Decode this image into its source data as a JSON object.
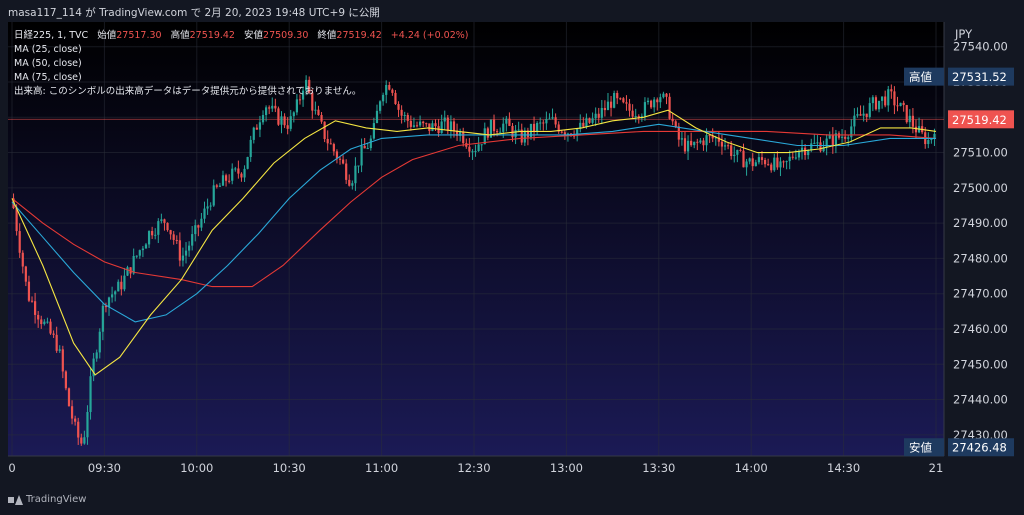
{
  "header": {
    "publish_text": "masa117_114 が TradingView.com で 2月 20, 2023 19:48 UTC+9 に公開"
  },
  "legend": {
    "symbol": "日経225, 1, TVC",
    "open_label": "始値",
    "open": "27517.30",
    "high_label": "高値",
    "high": "27519.42",
    "low_label": "安値",
    "low": "27509.30",
    "close_label": "終値",
    "close": "27519.42",
    "change": "+4.24 (+0.02%)",
    "ma1": "MA (25, close)",
    "ma2": "MA (50, close)",
    "ma3": "MA (75, close)",
    "volume_note": "出来高: このシンボルの出来高データはデータ提供元から提供されておりません。"
  },
  "footer": {
    "brand": "TradingView"
  },
  "colors": {
    "up": "#26a69a",
    "down": "#ef5350",
    "ma25": "#f5e642",
    "ma50": "#2aa8d8",
    "ma75": "#e53935",
    "bg_top": "#000000",
    "bg_bottom": "#1b1a55",
    "axis_bg": "#131722"
  },
  "chart_data": {
    "type": "candlestick",
    "currency": "JPY",
    "y_range": [
      27424,
      27547
    ],
    "y_ticks": [
      27430,
      27440,
      27450,
      27460,
      27470,
      27480,
      27490,
      27500,
      27510,
      27520,
      27530,
      27540
    ],
    "x_ticks": [
      {
        "label": "0",
        "t": 0
      },
      {
        "label": "09:30",
        "t": 30
      },
      {
        "label": "10:00",
        "t": 60
      },
      {
        "label": "10:30",
        "t": 90
      },
      {
        "label": "11:00",
        "t": 120
      },
      {
        "label": "12:30",
        "t": 150
      },
      {
        "label": "13:00",
        "t": 180
      },
      {
        "label": "13:30",
        "t": 210
      },
      {
        "label": "14:00",
        "t": 240
      },
      {
        "label": "14:30",
        "t": 270
      },
      {
        "label": "21",
        "t": 300
      }
    ],
    "markers": {
      "high": {
        "label": "高値",
        "value": "27531.52"
      },
      "last": {
        "value": "27519.42"
      },
      "low": {
        "label": "安値",
        "value": "27426.48"
      }
    },
    "price_path": [
      [
        0,
        27497
      ],
      [
        5,
        27470
      ],
      [
        10,
        27462
      ],
      [
        15,
        27455
      ],
      [
        18,
        27440
      ],
      [
        21,
        27430
      ],
      [
        23,
        27427
      ],
      [
        26,
        27448
      ],
      [
        30,
        27468
      ],
      [
        35,
        27472
      ],
      [
        40,
        27480
      ],
      [
        45,
        27488
      ],
      [
        50,
        27491
      ],
      [
        55,
        27480
      ],
      [
        60,
        27488
      ],
      [
        65,
        27498
      ],
      [
        70,
        27503
      ],
      [
        75,
        27505
      ],
      [
        78,
        27514
      ],
      [
        82,
        27524
      ],
      [
        86,
        27520
      ],
      [
        90,
        27518
      ],
      [
        93,
        27524
      ],
      [
        95,
        27531
      ],
      [
        98,
        27522
      ],
      [
        102,
        27514
      ],
      [
        107,
        27507
      ],
      [
        110,
        27502
      ],
      [
        113,
        27509
      ],
      [
        117,
        27514
      ],
      [
        120,
        27528
      ],
      [
        123,
        27530
      ],
      [
        126,
        27521
      ],
      [
        130,
        27518
      ],
      [
        135,
        27517
      ],
      [
        140,
        27518
      ],
      [
        145,
        27516
      ],
      [
        150,
        27511
      ],
      [
        155,
        27517
      ],
      [
        160,
        27518
      ],
      [
        165,
        27514
      ],
      [
        170,
        27517
      ],
      [
        175,
        27519
      ],
      [
        180,
        27516
      ],
      [
        185,
        27517
      ],
      [
        190,
        27520
      ],
      [
        195,
        27525
      ],
      [
        200,
        27522
      ],
      [
        205,
        27522
      ],
      [
        210,
        27527
      ],
      [
        213,
        27523
      ],
      [
        216,
        27514
      ],
      [
        220,
        27511
      ],
      [
        225,
        27514
      ],
      [
        230,
        27514
      ],
      [
        235,
        27509
      ],
      [
        240,
        27507
      ],
      [
        245,
        27508
      ],
      [
        250,
        27505
      ],
      [
        255,
        27511
      ],
      [
        260,
        27512
      ],
      [
        265,
        27513
      ],
      [
        270,
        27515
      ],
      [
        275,
        27520
      ],
      [
        280,
        27524
      ],
      [
        285,
        27526
      ],
      [
        290,
        27521
      ],
      [
        295,
        27515
      ],
      [
        298,
        27513
      ],
      [
        300,
        27519
      ]
    ],
    "ma25": [
      [
        0,
        27497
      ],
      [
        10,
        27478
      ],
      [
        20,
        27456
      ],
      [
        27,
        27447
      ],
      [
        35,
        27452
      ],
      [
        45,
        27464
      ],
      [
        55,
        27474
      ],
      [
        65,
        27488
      ],
      [
        75,
        27497
      ],
      [
        85,
        27507
      ],
      [
        95,
        27514
      ],
      [
        105,
        27519
      ],
      [
        115,
        27517
      ],
      [
        125,
        27516
      ],
      [
        135,
        27517
      ],
      [
        145,
        27516
      ],
      [
        155,
        27515
      ],
      [
        165,
        27516
      ],
      [
        175,
        27516
      ],
      [
        185,
        27517
      ],
      [
        195,
        27519
      ],
      [
        205,
        27520
      ],
      [
        213,
        27522
      ],
      [
        222,
        27517
      ],
      [
        232,
        27513
      ],
      [
        242,
        27510
      ],
      [
        252,
        27510
      ],
      [
        262,
        27511
      ],
      [
        272,
        27513
      ],
      [
        282,
        27517
      ],
      [
        292,
        27517
      ],
      [
        300,
        27516
      ]
    ],
    "ma50": [
      [
        0,
        27496
      ],
      [
        10,
        27486
      ],
      [
        20,
        27476
      ],
      [
        30,
        27467
      ],
      [
        40,
        27462
      ],
      [
        50,
        27464
      ],
      [
        60,
        27470
      ],
      [
        70,
        27478
      ],
      [
        80,
        27487
      ],
      [
        90,
        27497
      ],
      [
        100,
        27505
      ],
      [
        110,
        27511
      ],
      [
        120,
        27514
      ],
      [
        135,
        27515
      ],
      [
        150,
        27515
      ],
      [
        165,
        27515
      ],
      [
        180,
        27515
      ],
      [
        195,
        27516
      ],
      [
        210,
        27518
      ],
      [
        225,
        27516
      ],
      [
        240,
        27514
      ],
      [
        255,
        27512
      ],
      [
        270,
        27512
      ],
      [
        285,
        27514
      ],
      [
        300,
        27514
      ]
    ],
    "ma75": [
      [
        0,
        27497
      ],
      [
        10,
        27490
      ],
      [
        20,
        27484
      ],
      [
        30,
        27479
      ],
      [
        40,
        27476
      ],
      [
        55,
        27474
      ],
      [
        65,
        27472
      ],
      [
        78,
        27472
      ],
      [
        88,
        27478
      ],
      [
        100,
        27488
      ],
      [
        110,
        27496
      ],
      [
        120,
        27503
      ],
      [
        130,
        27508
      ],
      [
        145,
        27512
      ],
      [
        165,
        27514
      ],
      [
        185,
        27515
      ],
      [
        205,
        27516
      ],
      [
        225,
        27516
      ],
      [
        245,
        27516
      ],
      [
        265,
        27515
      ],
      [
        285,
        27515
      ],
      [
        300,
        27514
      ]
    ]
  }
}
